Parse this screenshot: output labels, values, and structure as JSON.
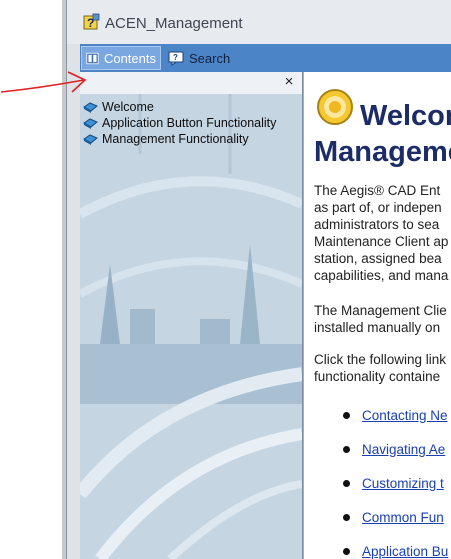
{
  "window": {
    "title": "ACEN_Management"
  },
  "toolbar": {
    "tabs": [
      {
        "label": "Contents",
        "icon": "book-icon",
        "active": true
      },
      {
        "label": "Search",
        "icon": "search-balloon-icon",
        "active": false
      }
    ]
  },
  "nav": {
    "close_glyph": "×",
    "items": [
      {
        "label": "Welcome",
        "icon": "help-topic-icon"
      },
      {
        "label": "Application Button Functionality",
        "icon": "help-topic-icon"
      },
      {
        "label": "Management Functionality",
        "icon": "help-topic-icon"
      }
    ]
  },
  "content": {
    "heading_line1": "Welcome",
    "heading_line2": "Management",
    "para1_lines": [
      "The Aegis® CAD Ent",
      "as part of, or indepen",
      "administrators to sea",
      "Maintenance Client ap",
      "station, assigned bea",
      "capabilities, and mana"
    ],
    "para2_lines": [
      "The Management Clie",
      "installed manually on"
    ],
    "para3_lines": [
      "Click the following link",
      "functionality containe"
    ],
    "links": [
      "Contacting Ne",
      "Navigating Ae",
      "Customizing t",
      "Common Fun",
      "Application Bu"
    ]
  },
  "colors": {
    "toolbar": "#4c84c8",
    "heading": "#1c2c66",
    "link": "#1a3fae",
    "nav_bg": "#c3d3e0",
    "annotation": "#e02020"
  }
}
